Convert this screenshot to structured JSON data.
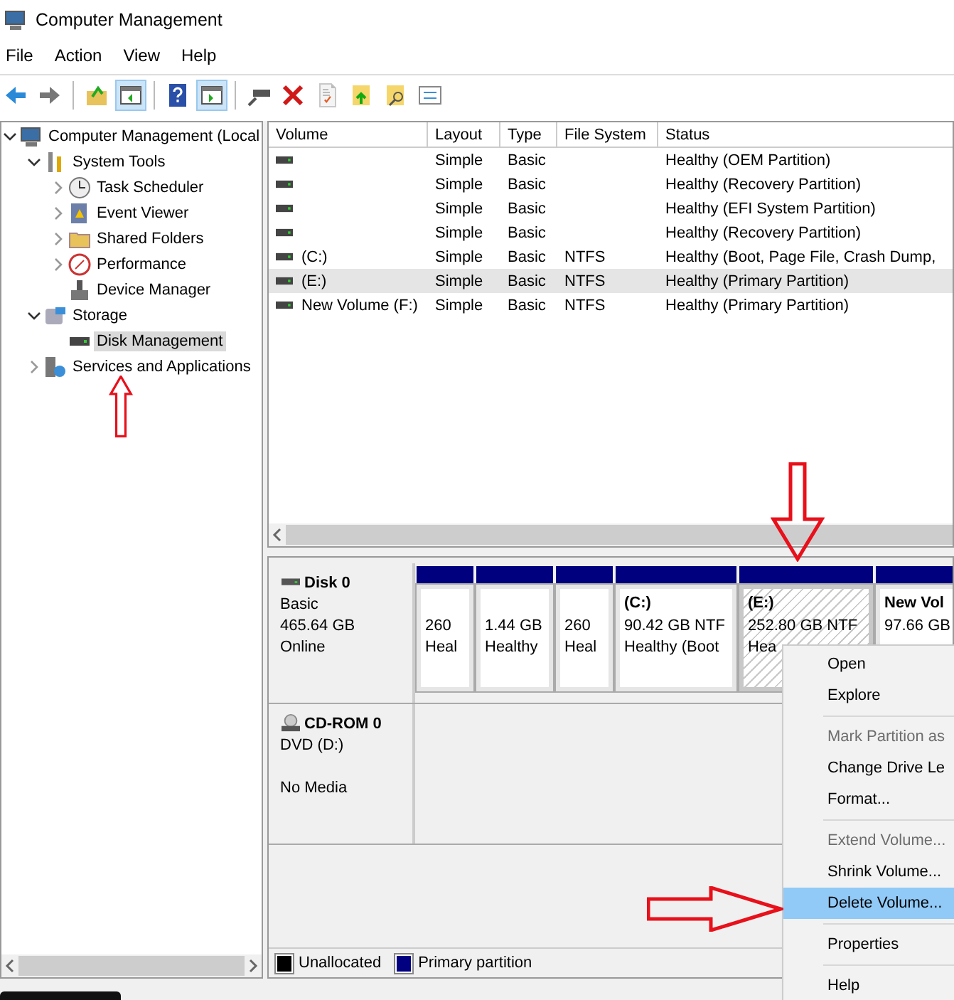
{
  "window": {
    "title": "Computer Management"
  },
  "menu": [
    "File",
    "Action",
    "View",
    "Help"
  ],
  "toolbar": [
    {
      "kind": "back",
      "pressed": false
    },
    {
      "kind": "forward",
      "pressed": false
    },
    {
      "kind": "up",
      "pressed": false
    },
    {
      "kind": "tree",
      "pressed": true
    },
    {
      "kind": "help",
      "pressed": false
    },
    {
      "kind": "pane",
      "pressed": true
    },
    {
      "kind": "connect",
      "pressed": false
    },
    {
      "kind": "delete",
      "pressed": false
    },
    {
      "kind": "check",
      "pressed": false
    },
    {
      "kind": "folder-up",
      "pressed": false
    },
    {
      "kind": "folder-search",
      "pressed": false
    },
    {
      "kind": "props",
      "pressed": false
    }
  ],
  "tree": [
    {
      "label": "Computer Management (Local",
      "expanded": true,
      "selected": false,
      "children": [
        {
          "label": "System Tools",
          "expanded": true,
          "selected": false,
          "children": [
            {
              "label": "Task Scheduler",
              "expanded": false,
              "selected": false
            },
            {
              "label": "Event Viewer",
              "expanded": false,
              "selected": false
            },
            {
              "label": "Shared Folders",
              "expanded": false,
              "selected": false
            },
            {
              "label": "Performance",
              "expanded": false,
              "selected": false
            },
            {
              "label": "Device Manager",
              "selected": false
            }
          ]
        },
        {
          "label": "Storage",
          "expanded": true,
          "selected": false,
          "children": [
            {
              "label": "Disk Management",
              "selected": true
            }
          ]
        },
        {
          "label": "Services and Applications",
          "expanded": false,
          "selected": false
        }
      ]
    }
  ],
  "table": {
    "columns": [
      "Volume",
      "Layout",
      "Type",
      "File System",
      "Status"
    ],
    "rows": [
      {
        "layout": "Simple",
        "type": "Basic",
        "status": "Healthy (OEM Partition)",
        "selected": false
      },
      {
        "layout": "Simple",
        "type": "Basic",
        "status": "Healthy (Recovery Partition)",
        "selected": false
      },
      {
        "layout": "Simple",
        "type": "Basic",
        "status": "Healthy (EFI System Partition)",
        "selected": false
      },
      {
        "layout": "Simple",
        "type": "Basic",
        "status": "Healthy (Recovery Partition)",
        "selected": false
      },
      {
        "volume": "(C:)",
        "layout": "Simple",
        "type": "Basic",
        "file_system": "NTFS",
        "status": "Healthy (Boot, Page File, Crash Dump,",
        "selected": false
      },
      {
        "volume": "(E:)",
        "layout": "Simple",
        "type": "Basic",
        "file_system": "NTFS",
        "status": "Healthy (Primary Partition)",
        "selected": true
      },
      {
        "volume": "New Volume (F:)",
        "layout": "Simple",
        "type": "Basic",
        "file_system": "NTFS",
        "status": "Healthy (Primary Partition)",
        "selected": false
      }
    ]
  },
  "disks": [
    {
      "kind": "disk",
      "name": "Disk 0",
      "lines": [
        "Basic",
        "465.64 GB",
        "Online"
      ],
      "partitions": [
        {
          "size": "260",
          "status": "Heal",
          "selected": false
        },
        {
          "size": "1.44 GB",
          "status": "Healthy",
          "selected": false
        },
        {
          "size": "260",
          "status": "Heal",
          "selected": false
        },
        {
          "label": "(C:)",
          "size": "90.42 GB NTF",
          "status": "Healthy (Boot",
          "selected": false
        },
        {
          "label": "(E:)",
          "size": "252.80 GB NTF",
          "status": "Hea",
          "selected": true
        },
        {
          "label": "New Vol",
          "size": "97.66 GB",
          "selected": false
        }
      ]
    },
    {
      "kind": "cdrom",
      "name": "CD-ROM 0",
      "lines": [
        "DVD (D:)",
        "No Media"
      ]
    }
  ],
  "legend": [
    {
      "label": "Unallocated",
      "color": "#000000"
    },
    {
      "label": "Primary partition",
      "color": "#000080"
    }
  ],
  "context_menu": [
    {
      "label": "Open",
      "disabled": false,
      "selected": false,
      "separator_after": false
    },
    {
      "label": "Explore",
      "disabled": false,
      "selected": false,
      "separator_after": true
    },
    {
      "label": "Mark Partition as",
      "disabled": true,
      "selected": false,
      "separator_after": false
    },
    {
      "label": "Change Drive Le",
      "disabled": false,
      "selected": false,
      "separator_after": false
    },
    {
      "label": "Format...",
      "disabled": false,
      "selected": false,
      "separator_after": true
    },
    {
      "label": "Extend Volume...",
      "disabled": true,
      "selected": false,
      "separator_after": false
    },
    {
      "label": "Shrink Volume...",
      "disabled": false,
      "selected": false,
      "separator_after": false
    },
    {
      "label": "Delete Volume...",
      "disabled": false,
      "selected": true,
      "separator_after": true
    },
    {
      "label": "Properties",
      "disabled": false,
      "selected": false,
      "separator_after": true
    },
    {
      "label": "Help",
      "disabled": false,
      "selected": false,
      "separator_after": false
    }
  ]
}
